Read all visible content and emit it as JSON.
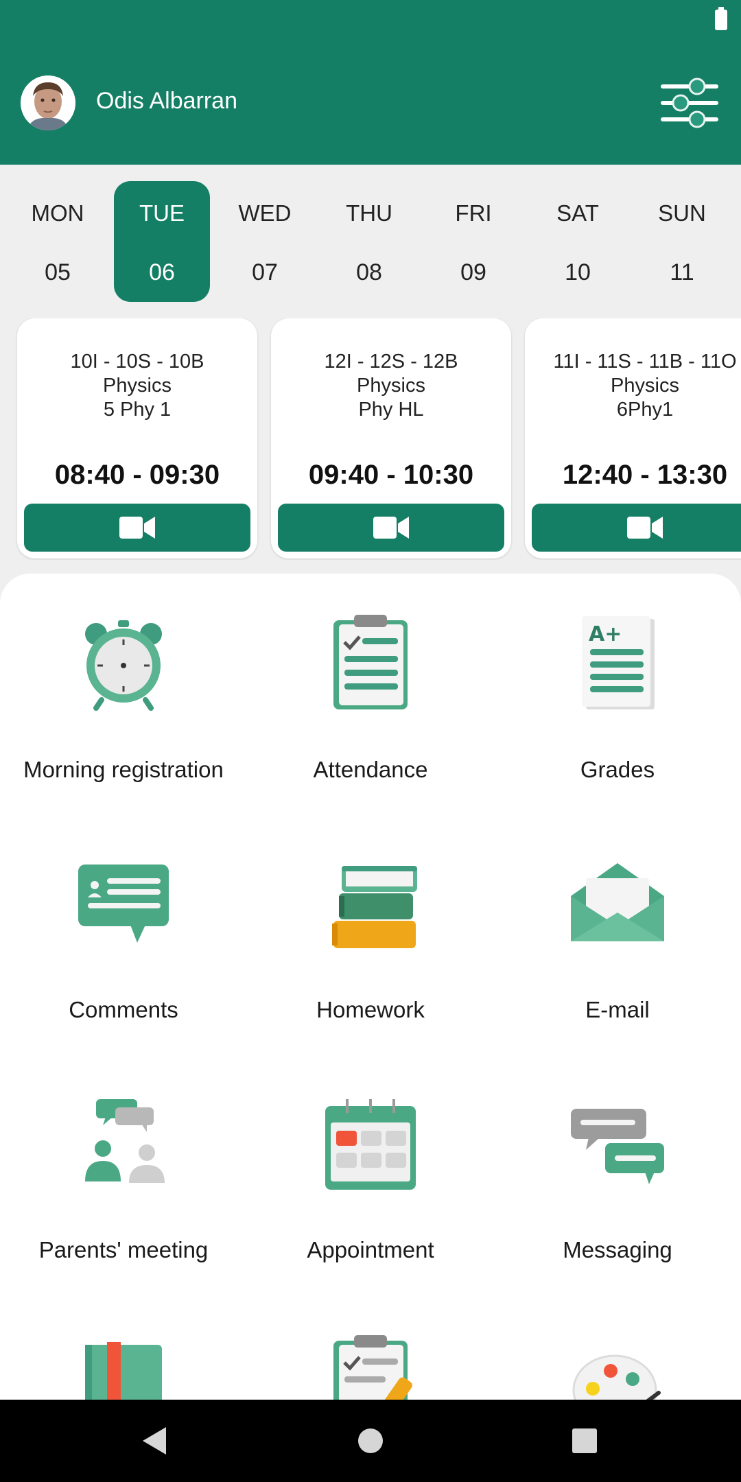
{
  "status_bar": {
    "battery_icon": "battery-full-icon"
  },
  "header": {
    "user_name": "Odis Albarran",
    "filter_icon": "sliders-icon",
    "accent_color": "#157f66"
  },
  "week": {
    "days": [
      {
        "name": "MON",
        "num": "05"
      },
      {
        "name": "TUE",
        "num": "06",
        "selected": true
      },
      {
        "name": "WED",
        "num": "07"
      },
      {
        "name": "THU",
        "num": "08"
      },
      {
        "name": "FRI",
        "num": "09"
      },
      {
        "name": "SAT",
        "num": "10"
      },
      {
        "name": "SUN",
        "num": "11"
      }
    ]
  },
  "lessons": [
    {
      "classes": "10I - 10S - 10B",
      "subject": "Physics",
      "group": "5 Phy 1",
      "time": "08:40 - 09:30"
    },
    {
      "classes": "12I - 12S - 12B",
      "subject": "Physics",
      "group": "Phy HL",
      "time": "09:40 - 10:30"
    },
    {
      "classes": "11I - 11S - 11B - 11O",
      "subject": "Physics",
      "group": "6Phy1",
      "time": "12:40 - 13:30"
    }
  ],
  "menu": [
    {
      "label": "Morning registration",
      "icon": "alarm-clock-icon"
    },
    {
      "label": "Attendance",
      "icon": "clipboard-check-icon"
    },
    {
      "label": "Grades",
      "icon": "grade-sheet-icon"
    },
    {
      "label": "Comments",
      "icon": "comment-bubble-icon"
    },
    {
      "label": "Homework",
      "icon": "books-icon"
    },
    {
      "label": "E-mail",
      "icon": "envelope-icon"
    },
    {
      "label": "Parents' meeting",
      "icon": "meeting-icon"
    },
    {
      "label": "Appointment",
      "icon": "calendar-icon"
    },
    {
      "label": "Messaging",
      "icon": "chat-icon"
    },
    {
      "label": "",
      "icon": "notebook-icon"
    },
    {
      "label": "",
      "icon": "clipboard-edit-icon"
    },
    {
      "label": "",
      "icon": "palette-icon"
    }
  ],
  "navbar": {
    "back_icon": "back-icon",
    "home_icon": "home-icon",
    "recents_icon": "recents-icon"
  }
}
